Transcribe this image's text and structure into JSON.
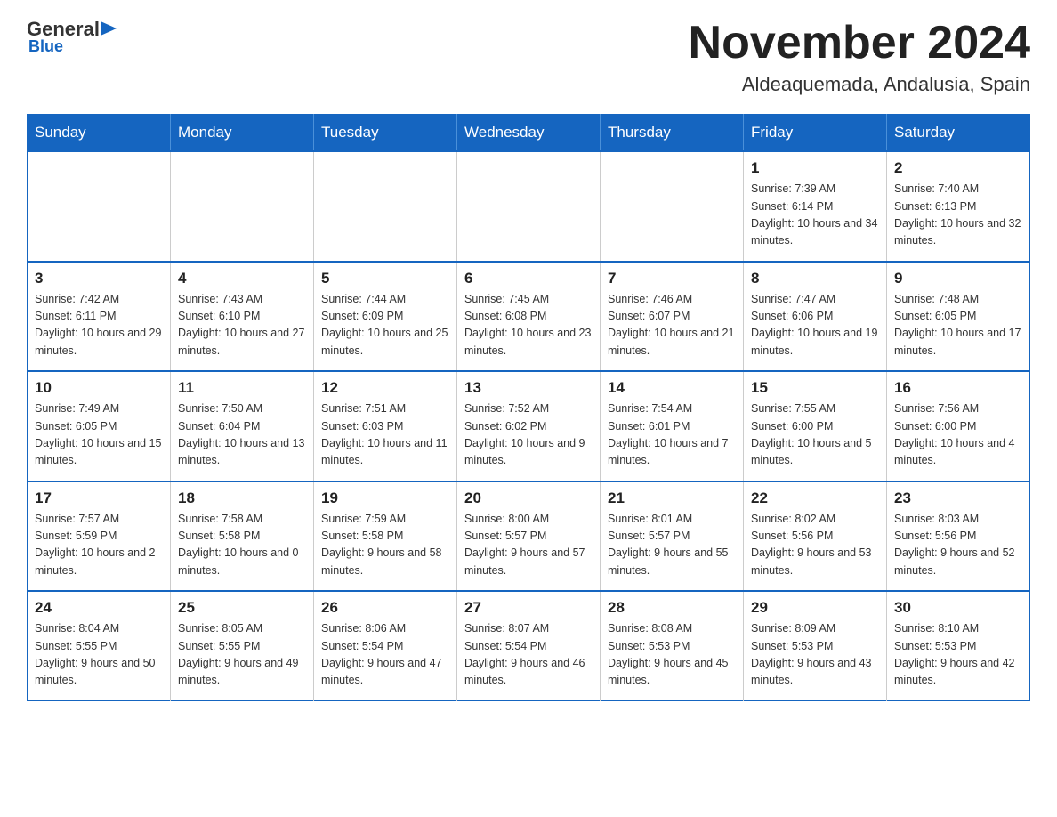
{
  "logo": {
    "general": "General",
    "blue_text": "Blue",
    "underline": "Blue"
  },
  "title": "November 2024",
  "location": "Aldeaquemada, Andalusia, Spain",
  "days_of_week": [
    "Sunday",
    "Monday",
    "Tuesday",
    "Wednesday",
    "Thursday",
    "Friday",
    "Saturday"
  ],
  "weeks": [
    [
      {
        "day": "",
        "info": ""
      },
      {
        "day": "",
        "info": ""
      },
      {
        "day": "",
        "info": ""
      },
      {
        "day": "",
        "info": ""
      },
      {
        "day": "",
        "info": ""
      },
      {
        "day": "1",
        "info": "Sunrise: 7:39 AM\nSunset: 6:14 PM\nDaylight: 10 hours and 34 minutes."
      },
      {
        "day": "2",
        "info": "Sunrise: 7:40 AM\nSunset: 6:13 PM\nDaylight: 10 hours and 32 minutes."
      }
    ],
    [
      {
        "day": "3",
        "info": "Sunrise: 7:42 AM\nSunset: 6:11 PM\nDaylight: 10 hours and 29 minutes."
      },
      {
        "day": "4",
        "info": "Sunrise: 7:43 AM\nSunset: 6:10 PM\nDaylight: 10 hours and 27 minutes."
      },
      {
        "day": "5",
        "info": "Sunrise: 7:44 AM\nSunset: 6:09 PM\nDaylight: 10 hours and 25 minutes."
      },
      {
        "day": "6",
        "info": "Sunrise: 7:45 AM\nSunset: 6:08 PM\nDaylight: 10 hours and 23 minutes."
      },
      {
        "day": "7",
        "info": "Sunrise: 7:46 AM\nSunset: 6:07 PM\nDaylight: 10 hours and 21 minutes."
      },
      {
        "day": "8",
        "info": "Sunrise: 7:47 AM\nSunset: 6:06 PM\nDaylight: 10 hours and 19 minutes."
      },
      {
        "day": "9",
        "info": "Sunrise: 7:48 AM\nSunset: 6:05 PM\nDaylight: 10 hours and 17 minutes."
      }
    ],
    [
      {
        "day": "10",
        "info": "Sunrise: 7:49 AM\nSunset: 6:05 PM\nDaylight: 10 hours and 15 minutes."
      },
      {
        "day": "11",
        "info": "Sunrise: 7:50 AM\nSunset: 6:04 PM\nDaylight: 10 hours and 13 minutes."
      },
      {
        "day": "12",
        "info": "Sunrise: 7:51 AM\nSunset: 6:03 PM\nDaylight: 10 hours and 11 minutes."
      },
      {
        "day": "13",
        "info": "Sunrise: 7:52 AM\nSunset: 6:02 PM\nDaylight: 10 hours and 9 minutes."
      },
      {
        "day": "14",
        "info": "Sunrise: 7:54 AM\nSunset: 6:01 PM\nDaylight: 10 hours and 7 minutes."
      },
      {
        "day": "15",
        "info": "Sunrise: 7:55 AM\nSunset: 6:00 PM\nDaylight: 10 hours and 5 minutes."
      },
      {
        "day": "16",
        "info": "Sunrise: 7:56 AM\nSunset: 6:00 PM\nDaylight: 10 hours and 4 minutes."
      }
    ],
    [
      {
        "day": "17",
        "info": "Sunrise: 7:57 AM\nSunset: 5:59 PM\nDaylight: 10 hours and 2 minutes."
      },
      {
        "day": "18",
        "info": "Sunrise: 7:58 AM\nSunset: 5:58 PM\nDaylight: 10 hours and 0 minutes."
      },
      {
        "day": "19",
        "info": "Sunrise: 7:59 AM\nSunset: 5:58 PM\nDaylight: 9 hours and 58 minutes."
      },
      {
        "day": "20",
        "info": "Sunrise: 8:00 AM\nSunset: 5:57 PM\nDaylight: 9 hours and 57 minutes."
      },
      {
        "day": "21",
        "info": "Sunrise: 8:01 AM\nSunset: 5:57 PM\nDaylight: 9 hours and 55 minutes."
      },
      {
        "day": "22",
        "info": "Sunrise: 8:02 AM\nSunset: 5:56 PM\nDaylight: 9 hours and 53 minutes."
      },
      {
        "day": "23",
        "info": "Sunrise: 8:03 AM\nSunset: 5:56 PM\nDaylight: 9 hours and 52 minutes."
      }
    ],
    [
      {
        "day": "24",
        "info": "Sunrise: 8:04 AM\nSunset: 5:55 PM\nDaylight: 9 hours and 50 minutes."
      },
      {
        "day": "25",
        "info": "Sunrise: 8:05 AM\nSunset: 5:55 PM\nDaylight: 9 hours and 49 minutes."
      },
      {
        "day": "26",
        "info": "Sunrise: 8:06 AM\nSunset: 5:54 PM\nDaylight: 9 hours and 47 minutes."
      },
      {
        "day": "27",
        "info": "Sunrise: 8:07 AM\nSunset: 5:54 PM\nDaylight: 9 hours and 46 minutes."
      },
      {
        "day": "28",
        "info": "Sunrise: 8:08 AM\nSunset: 5:53 PM\nDaylight: 9 hours and 45 minutes."
      },
      {
        "day": "29",
        "info": "Sunrise: 8:09 AM\nSunset: 5:53 PM\nDaylight: 9 hours and 43 minutes."
      },
      {
        "day": "30",
        "info": "Sunrise: 8:10 AM\nSunset: 5:53 PM\nDaylight: 9 hours and 42 minutes."
      }
    ]
  ]
}
